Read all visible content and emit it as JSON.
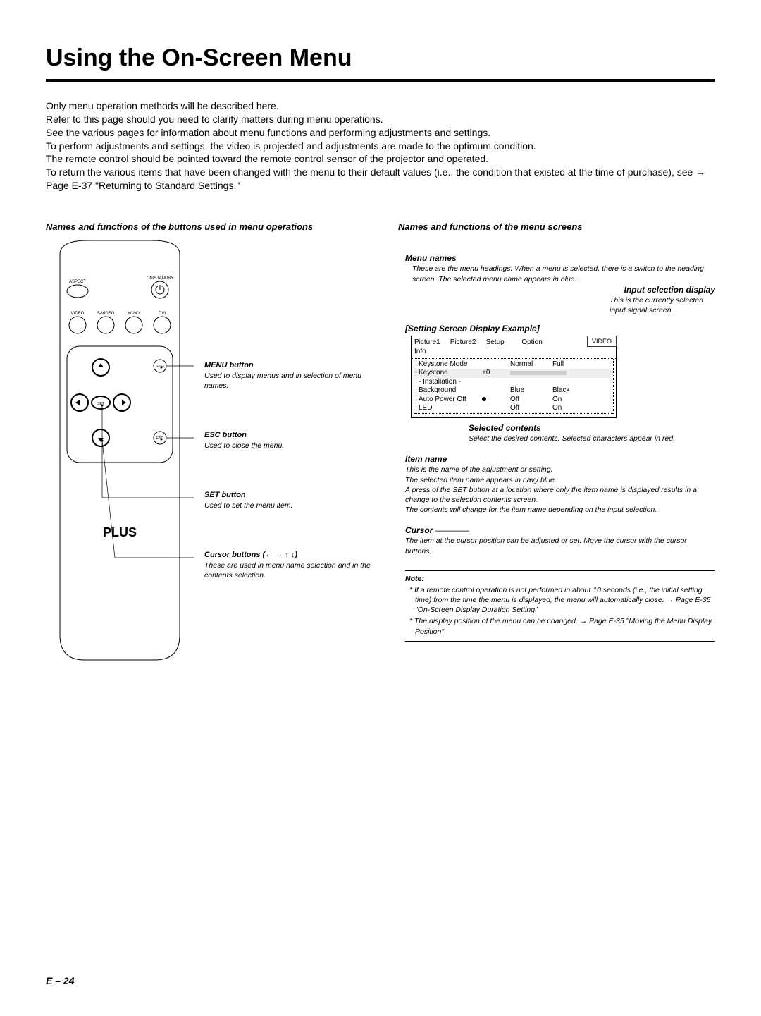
{
  "title": "Using the On-Screen Menu",
  "intro": {
    "l1": "Only menu operation methods will be described here.",
    "l2": "Refer to this page should you need to clarify matters during menu operations.",
    "l3": "See the various pages for information about menu functions and performing adjustments and settings.",
    "l4": "To perform adjustments and settings, the video is projected and adjustments are made to the optimum condition.",
    "l5": "The remote control should be pointed toward the remote control sensor of the projector and operated.",
    "l6": "To return the various items that have been changed with the menu to their default values (i.e., the condition that existed at the time of purchase), see → Page E-37 \"Returning to Standard Settings.\""
  },
  "left": {
    "heading": "Names and functions of the buttons used in menu operations",
    "remote": {
      "onstandby": "ON/STANDBY",
      "aspect": "ASPECT",
      "video": "VIDEO",
      "svideo": "S-VIDEO",
      "ycbcr": "YCbCr",
      "dvi": "DVI",
      "menu": "MENU",
      "esc": "ESC",
      "set": "SET",
      "brand": "PLUS"
    },
    "labels": {
      "menu_t": "MENU button",
      "menu_d": "Used to display menus and in selection of menu names.",
      "esc_t": "ESC button",
      "esc_d": "Used to close the menu.",
      "set_t": "SET button",
      "set_d": "Used to set the menu item.",
      "cur_t": "Cursor buttons (← → ↑ ↓)",
      "cur_d": "These are used in menu name selection and in the contents selection."
    }
  },
  "right": {
    "heading": "Names and functions of the menu screens",
    "menu_names_t": "Menu names",
    "menu_names_d": "These are the menu headings. When a menu is selected, there is a switch to the heading screen. The selected menu name appears in blue.",
    "input_sel_t": "Input selection display",
    "input_sel_d": "This is the currently selected input signal screen.",
    "setting_example": "[Setting Screen Display Example]",
    "menu_badge": "VIDEO",
    "tabs": {
      "t1": "Picture1",
      "t2": "Picture2",
      "t3": "Setup",
      "t4": "Option",
      "t5": "Info."
    },
    "rows": {
      "r1_l": "Keystone Mode",
      "r1_v2": "Normal",
      "r1_v3": "Full",
      "r2_l": "Keystone",
      "r2_v1": "+0",
      "r3_l": "- Installation -",
      "r4_l": "Background",
      "r4_v2": "Blue",
      "r4_v3": "Black",
      "r5_l": "Auto Power Off",
      "r5_v2": "Off",
      "r5_v3": "On",
      "r6_l": "LED",
      "r6_v2": "Off",
      "r6_v3": "On"
    },
    "sel_t": "Selected contents",
    "sel_d": "Select the desired contents. Selected characters appear in red.",
    "item_t": "Item name",
    "item_d": "This is the name of the adjustment or setting.\nThe selected item name appears in navy blue.\nA press of the SET button at a location where only the item name is displayed results in a change to the selection contents screen.\nThe contents will change for the item name depending on the input selection.",
    "cursor_t": "Cursor",
    "cursor_d": "The item at the cursor position can be adjusted or set. Move the cursor with the cursor buttons."
  },
  "note": {
    "title": "Note:",
    "n1": "If a remote control operation is not performed in about 10 seconds (i.e., the initial setting time) from the time the menu is displayed, the menu will automatically close. → Page E-35 \"On-Screen Display Duration Setting\"",
    "n2": "The display position of the menu can be changed. → Page E-35 \"Moving the Menu Display Position\""
  },
  "page_num": "E – 24"
}
